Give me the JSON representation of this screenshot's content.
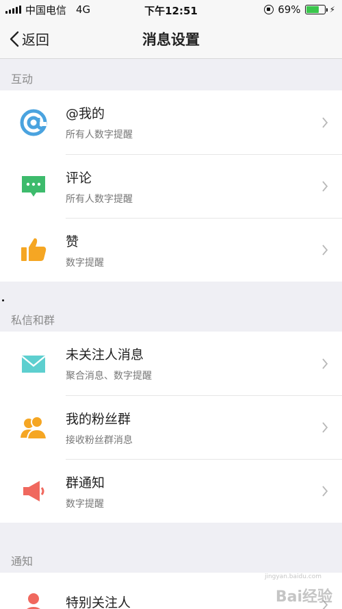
{
  "status_bar": {
    "carrier": "中国电信",
    "network": "4G",
    "time": "下午12:51",
    "battery_percent": "69%",
    "battery_level": 0.69
  },
  "nav": {
    "back_label": "返回",
    "title": "消息设置"
  },
  "sections": [
    {
      "header": "互动",
      "items": [
        {
          "title": "@我的",
          "subtitle": "所有人数字提醒",
          "icon": "at-icon"
        },
        {
          "title": "评论",
          "subtitle": "所有人数字提醒",
          "icon": "comment-icon"
        },
        {
          "title": "赞",
          "subtitle": "数字提醒",
          "icon": "thumbs-up-icon"
        }
      ]
    },
    {
      "header": "私信和群",
      "items": [
        {
          "title": "未关注人消息",
          "subtitle": "聚合消息、数字提醒",
          "icon": "envelope-icon"
        },
        {
          "title": "我的粉丝群",
          "subtitle": "接收粉丝群消息",
          "icon": "fan-group-icon"
        },
        {
          "title": "群通知",
          "subtitle": "数字提醒",
          "icon": "megaphone-icon"
        }
      ]
    },
    {
      "header": "通知",
      "items": [
        {
          "title": "特别关注人",
          "subtitle": "",
          "icon": "person-icon"
        }
      ]
    }
  ],
  "colors": {
    "at": "#4aa3df",
    "comment": "#3dbb6c",
    "like": "#f5a623",
    "envelope": "#5dcfcf",
    "fans": "#f5a623",
    "megaphone": "#f0685e",
    "person": "#f0685e"
  },
  "watermark": "Bai经验",
  "watermark_url": "jingyan.baidu.com"
}
